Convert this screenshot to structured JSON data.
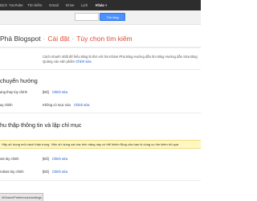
{
  "gbar": {
    "items": [
      "Dịch",
      "YouTube",
      "Tìm kiếm",
      "Gmail",
      "Drive",
      "Lịch",
      "Khác"
    ]
  },
  "search": {
    "button_label": "Tìm blog"
  },
  "title": {
    "blog": "Phả Blogspot",
    "separator": "·",
    "section": "Cài đặt",
    "page": "Tùy chọn tìm kiếm"
  },
  "description": "Cách nhanh nhất để hiểu Blog là thử với tìm Khám Phá Blog Hướng dẫn tìm Blog Hướng dẫn Sửa Blog Quảng cáo sản phẩm",
  "description_link": "Chỉnh sửa",
  "redirects": {
    "title": "chuyển hướng",
    "rows": [
      {
        "label": "ang thay tùy chỉnh",
        "value": "[Đã]",
        "link": "Chỉnh sửa"
      },
      {
        "label": "ay chỉnh",
        "value": "Không có mục nào",
        "link": "Chỉnh sửa"
      }
    ]
  },
  "crawlers": {
    "title": "hu thập thông tin và lập chỉ mục",
    "warning": "Hãy sử dụng một cách thận trọng. Việc sử dụng sai các tính năng này có thể khiến Blog của bạn bị công cụ tìm kiếm bỏ qua",
    "rows": [
      {
        "label": "ots tùy chỉnh",
        "value": "[Đã]",
        "link": "Chỉnh sửa"
      },
      {
        "label": "robots tùy chỉnh",
        "value": "[Đã]",
        "link": "Chỉnh sửa"
      }
    ]
  },
  "statusbar": {
    "text": "/#SearchPreferences/settings"
  }
}
